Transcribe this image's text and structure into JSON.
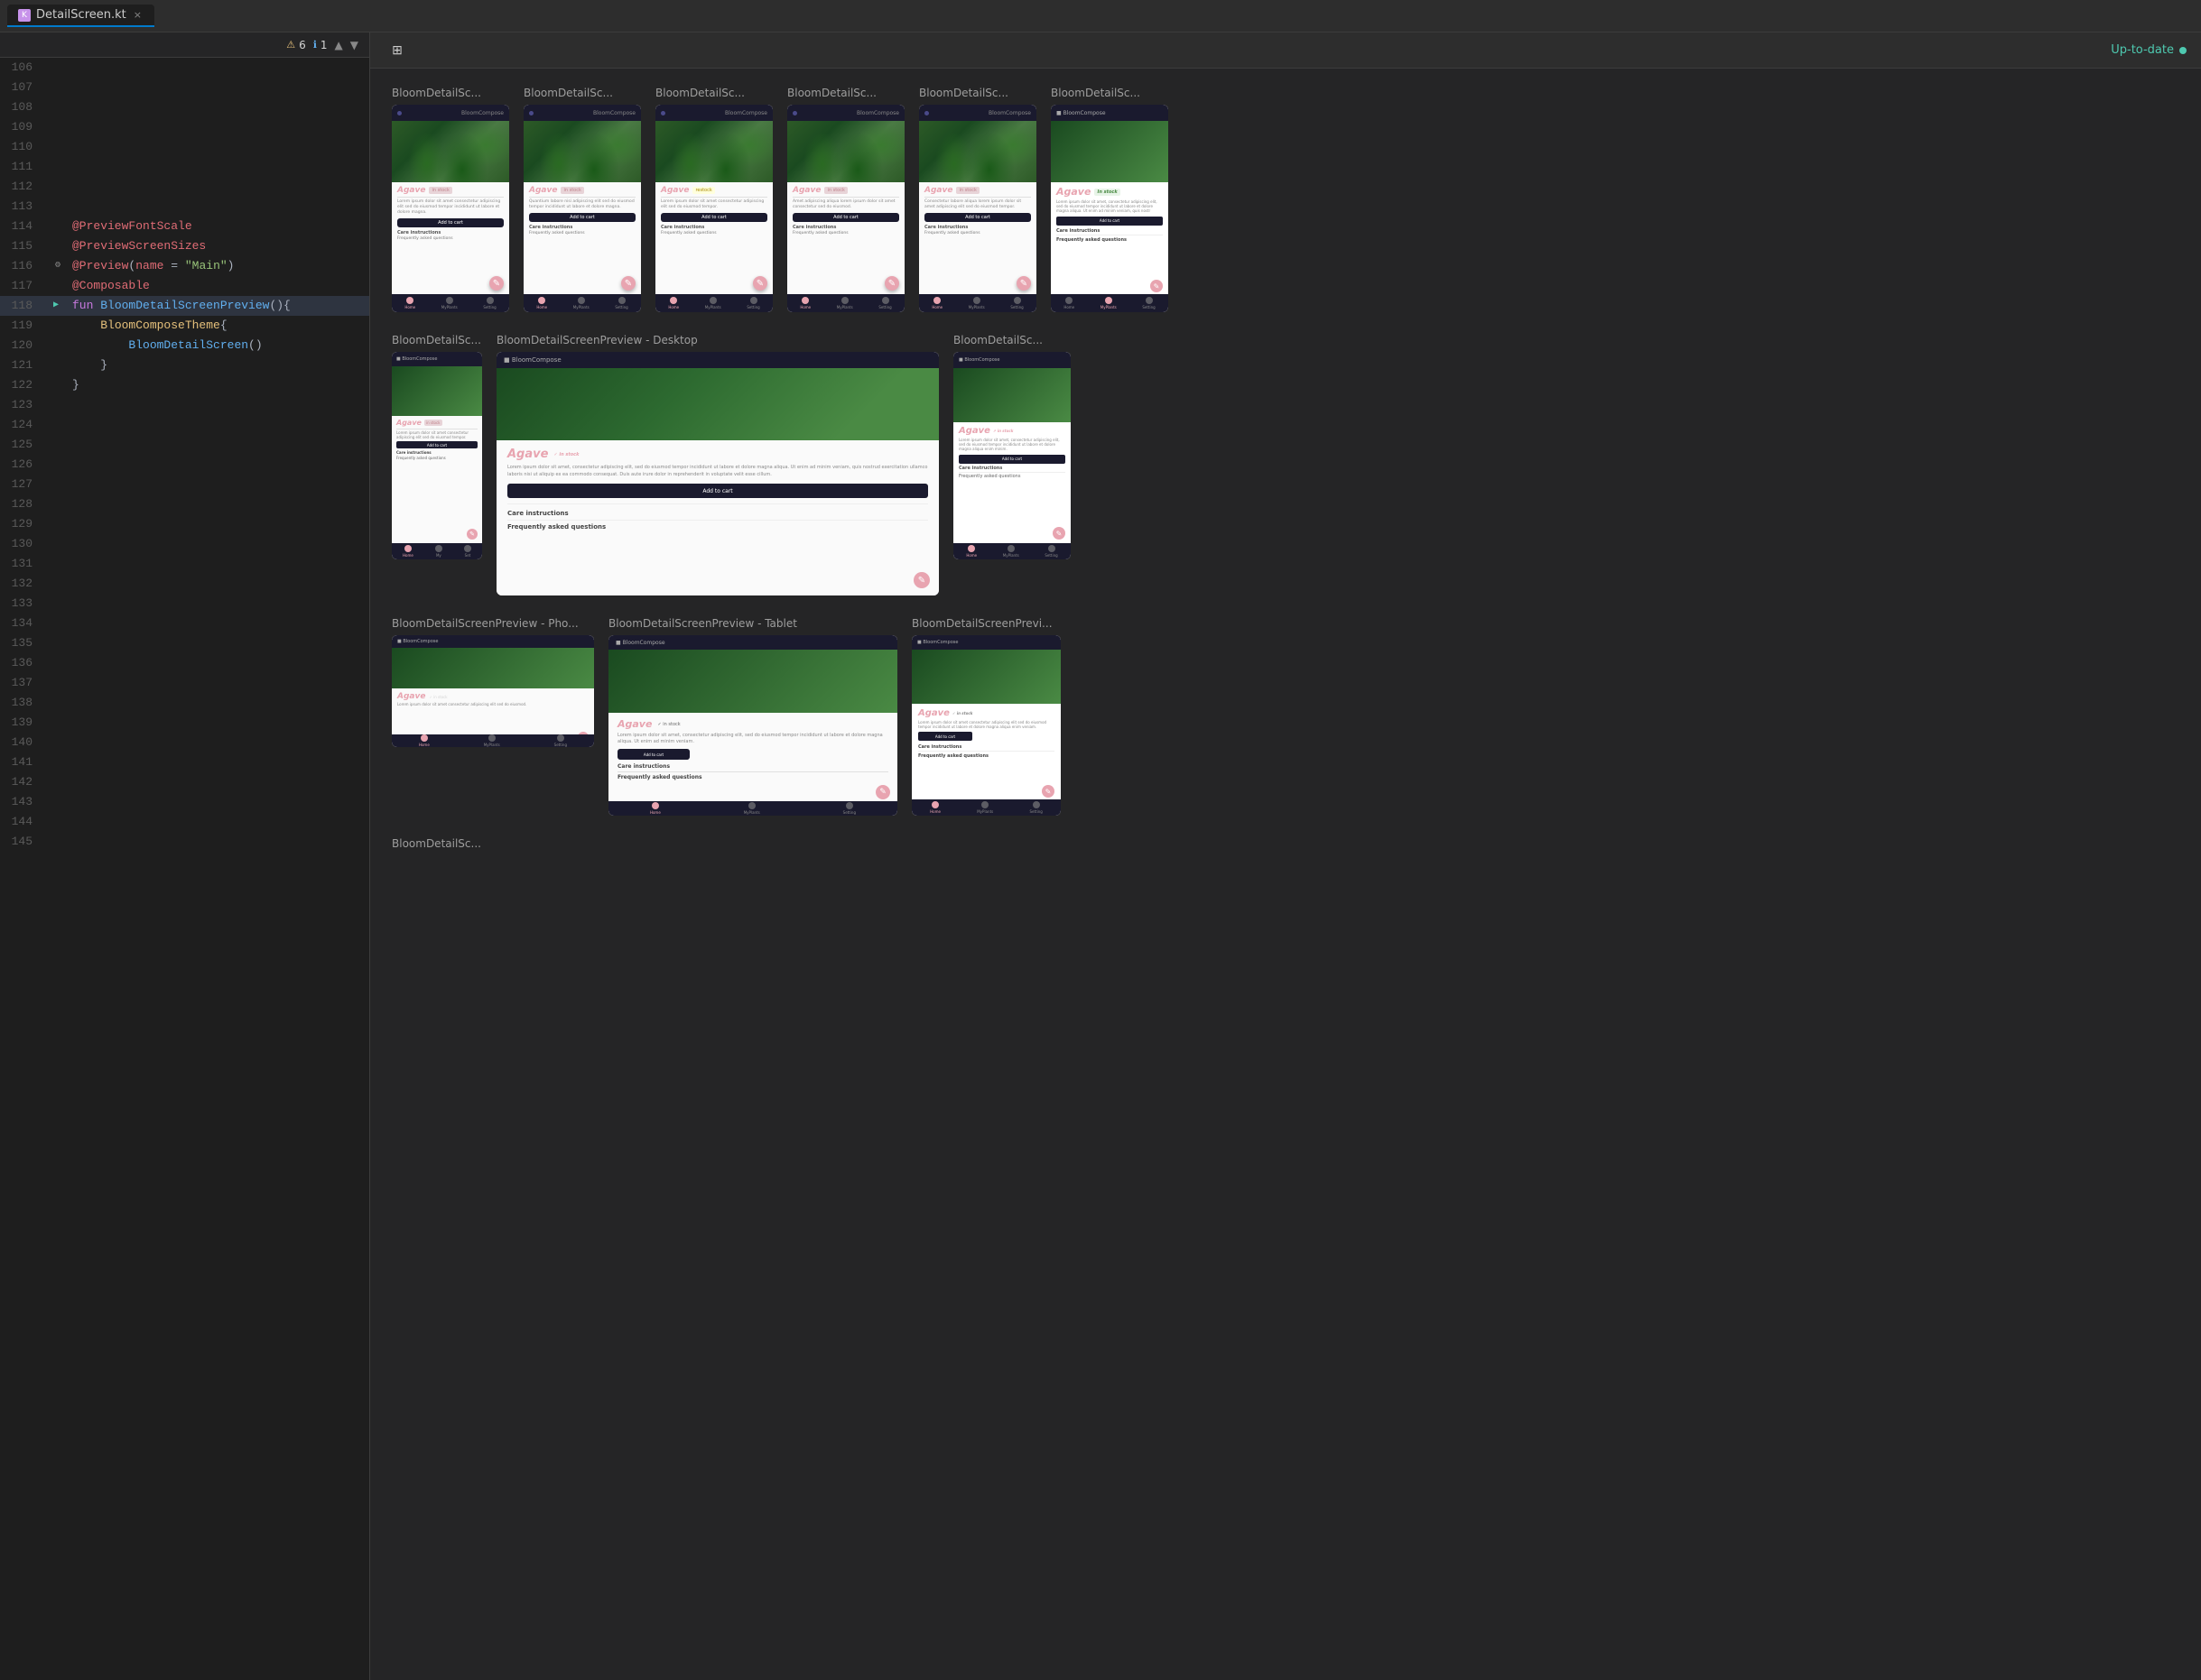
{
  "tab": {
    "filename": "DetailScreen.kt",
    "close_label": "×",
    "icon_label": "K"
  },
  "error_bar": {
    "warnings": "6",
    "infos": "1",
    "up_label": "▲",
    "down_label": "▼"
  },
  "toolbar": {
    "status_label": "Up-to-date",
    "grid_icon": "⊞",
    "layout_icon": "☰",
    "refresh_icon": "⟳",
    "more_icon": "⋯"
  },
  "code_lines": [
    {
      "num": "106",
      "content": "",
      "icon": ""
    },
    {
      "num": "107",
      "content": "",
      "icon": ""
    },
    {
      "num": "108",
      "content": "",
      "icon": ""
    },
    {
      "num": "109",
      "content": "",
      "icon": ""
    },
    {
      "num": "110",
      "content": "",
      "icon": ""
    },
    {
      "num": "111",
      "content": "",
      "icon": ""
    },
    {
      "num": "112",
      "content": "",
      "icon": ""
    },
    {
      "num": "113",
      "content": "",
      "icon": ""
    },
    {
      "num": "114",
      "content": "@PreviewFontScale",
      "icon": ""
    },
    {
      "num": "115",
      "content": "@PreviewScreenSizes",
      "icon": ""
    },
    {
      "num": "116",
      "content": "@Preview(name = \"Main\")",
      "icon": "⚙"
    },
    {
      "num": "117",
      "content": "@Composable",
      "icon": ""
    },
    {
      "num": "118",
      "content": "fun BloomDetailScreenPreview(){",
      "icon": "▶"
    },
    {
      "num": "119",
      "content": "    BloomComposeTheme{",
      "icon": ""
    },
    {
      "num": "120",
      "content": "        BloomDetailScreen()",
      "icon": ""
    },
    {
      "num": "121",
      "content": "    }",
      "icon": ""
    },
    {
      "num": "122",
      "content": "}",
      "icon": ""
    },
    {
      "num": "123",
      "content": "",
      "icon": ""
    },
    {
      "num": "124",
      "content": "",
      "icon": ""
    },
    {
      "num": "125",
      "content": "",
      "icon": ""
    },
    {
      "num": "126",
      "content": "",
      "icon": ""
    },
    {
      "num": "127",
      "content": "",
      "icon": ""
    },
    {
      "num": "128",
      "content": "",
      "icon": ""
    },
    {
      "num": "129",
      "content": "",
      "icon": ""
    },
    {
      "num": "130",
      "content": "",
      "icon": ""
    },
    {
      "num": "131",
      "content": "",
      "icon": ""
    },
    {
      "num": "132",
      "content": "",
      "icon": ""
    },
    {
      "num": "133",
      "content": "",
      "icon": ""
    },
    {
      "num": "134",
      "content": "",
      "icon": ""
    },
    {
      "num": "135",
      "content": "",
      "icon": ""
    },
    {
      "num": "136",
      "content": "",
      "icon": ""
    },
    {
      "num": "137",
      "content": "",
      "icon": ""
    },
    {
      "num": "138",
      "content": "",
      "icon": ""
    },
    {
      "num": "139",
      "content": "",
      "icon": ""
    },
    {
      "num": "140",
      "content": "",
      "icon": ""
    },
    {
      "num": "141",
      "content": "",
      "icon": ""
    },
    {
      "num": "142",
      "content": "",
      "icon": ""
    },
    {
      "num": "143",
      "content": "",
      "icon": ""
    },
    {
      "num": "144",
      "content": "",
      "icon": ""
    },
    {
      "num": "145",
      "content": "",
      "icon": ""
    }
  ],
  "previews": {
    "row1": [
      {
        "title": "BloomDetailSc...",
        "type": "phone"
      },
      {
        "title": "BloomDetailSc...",
        "type": "phone"
      },
      {
        "title": "BloomDetailSc...",
        "type": "phone"
      },
      {
        "title": "BloomDetailSc...",
        "type": "phone"
      },
      {
        "title": "BloomDetailSc...",
        "type": "phone"
      },
      {
        "title": "BloomDetailSc...",
        "type": "lorem"
      }
    ],
    "row2": [
      {
        "title": "BloomDetailSc...",
        "type": "phone_small"
      },
      {
        "title": "BloomDetailScreenPreview - Desktop",
        "type": "desktop"
      },
      {
        "title": "BloomDetailSc...",
        "type": "lorem_wide"
      }
    ],
    "row3": [
      {
        "title": "BloomDetailScreenPreview - Pho...",
        "type": "phone_med"
      },
      {
        "title": "BloomDetailScreenPreview - Tablet",
        "type": "tablet"
      },
      {
        "title": "BloomDetailScreenPrevi...",
        "type": "lorem_med"
      }
    ],
    "row4": [
      {
        "title": "BloomDetailSc...",
        "type": "phone"
      }
    ]
  },
  "plant": {
    "name": "Agave",
    "badge_in_stock": "In stock",
    "description_short": "Lorem ipsum dolor sit amet consectetur adipiscing elit sed do eiusmod tempor",
    "description_long": "Lorem ipsum dolor sit amet, consectetur adipiscing elit, sed do eiusmod tempor incididunt ut labore et dolore magna aliqua. Ut enim ad minim veniam, quis nostru",
    "add_to_cart": "Add to cart",
    "care_instructions": "Care instructions",
    "faq": "Frequently asked questions",
    "nav_home": "Home",
    "nav_my_plants": "MyPlants",
    "nav_settings": "Setting"
  }
}
